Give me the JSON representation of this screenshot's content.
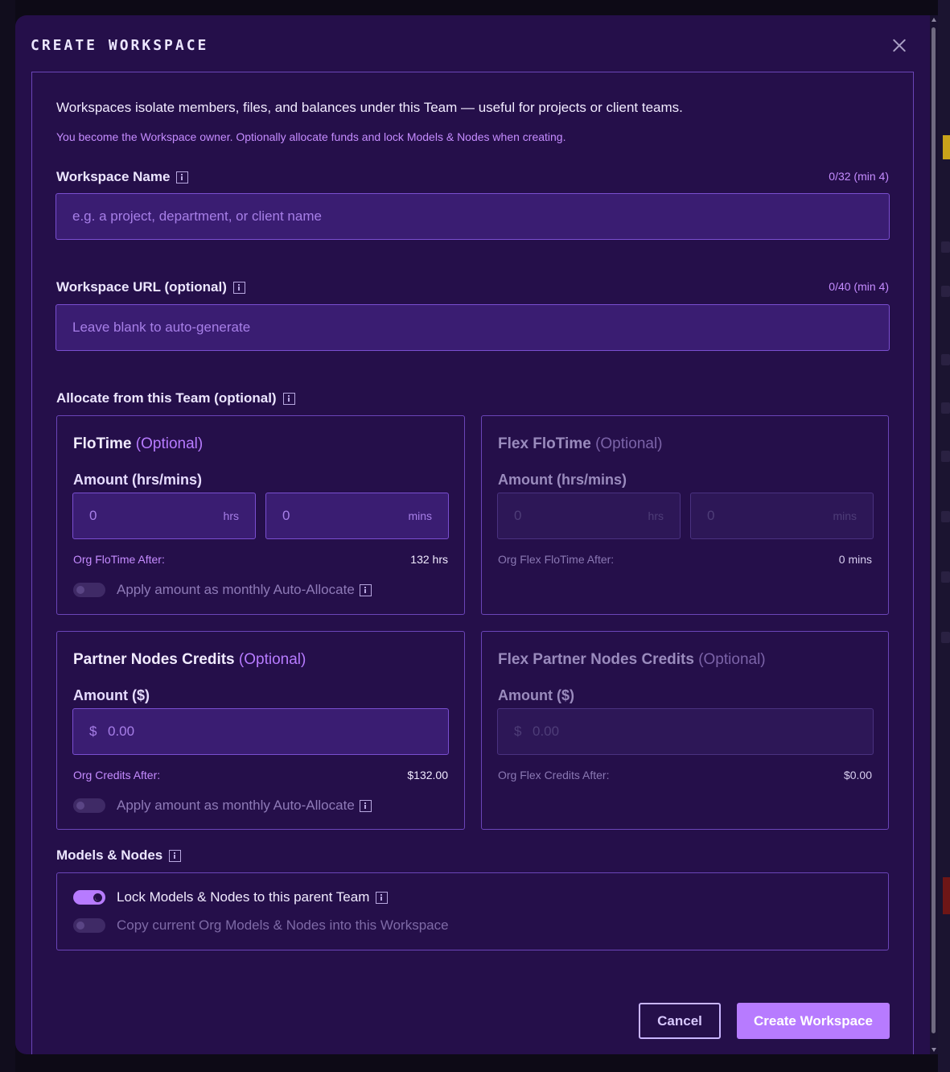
{
  "modal": {
    "title": "CREATE WORKSPACE",
    "intro": "Workspaces isolate members, files, and balances under this Team — useful for projects or client teams.",
    "intro_sub": "You become the Workspace owner. Optionally allocate funds and lock Models & Nodes when creating."
  },
  "workspace_name": {
    "label": "Workspace Name",
    "counter": "0/32 (min 4)",
    "placeholder": "e.g. a project, department, or client name",
    "value": ""
  },
  "workspace_url": {
    "label": "Workspace URL (optional)",
    "counter": "0/40 (min 4)",
    "placeholder": "Leave blank to auto-generate",
    "value": ""
  },
  "allocate": {
    "label": "Allocate from this Team (optional)",
    "flotime": {
      "title": "FloTime",
      "optional": "(Optional)",
      "amount_label": "Amount (hrs/mins)",
      "hrs_value": "0",
      "hrs_unit": "hrs",
      "mins_value": "0",
      "mins_unit": "mins",
      "after_label": "Org FloTime After:",
      "after_value": "132 hrs",
      "auto_allocate_label": "Apply amount as monthly Auto-Allocate",
      "auto_allocate_on": false
    },
    "flex_flotime": {
      "title": "Flex FloTime",
      "optional": "(Optional)",
      "amount_label": "Amount (hrs/mins)",
      "hrs_value": "0",
      "hrs_unit": "hrs",
      "mins_value": "0",
      "mins_unit": "mins",
      "after_label": "Org Flex FloTime After:",
      "after_value": "0 mins"
    },
    "partner_credits": {
      "title": "Partner Nodes Credits",
      "optional": "(Optional)",
      "amount_label": "Amount ($)",
      "currency": "$",
      "value": "0.00",
      "after_label": "Org Credits After:",
      "after_value": "$132.00",
      "auto_allocate_label": "Apply amount as monthly Auto-Allocate",
      "auto_allocate_on": false
    },
    "flex_partner_credits": {
      "title": "Flex Partner Nodes Credits",
      "optional": "(Optional)",
      "amount_label": "Amount ($)",
      "currency": "$",
      "value": "0.00",
      "after_label": "Org Flex Credits After:",
      "after_value": "$0.00"
    }
  },
  "models_nodes": {
    "label": "Models & Nodes",
    "lock_label": "Lock Models & Nodes to this parent Team",
    "lock_on": true,
    "copy_label": "Copy current Org Models & Nodes into this Workspace",
    "copy_on": false
  },
  "actions": {
    "cancel": "Cancel",
    "create": "Create Workspace"
  },
  "colors": {
    "modal_bg": "#250f4a",
    "accent": "#b77bff",
    "border": "#6b45b8",
    "input_bg": "#3a1d72"
  }
}
